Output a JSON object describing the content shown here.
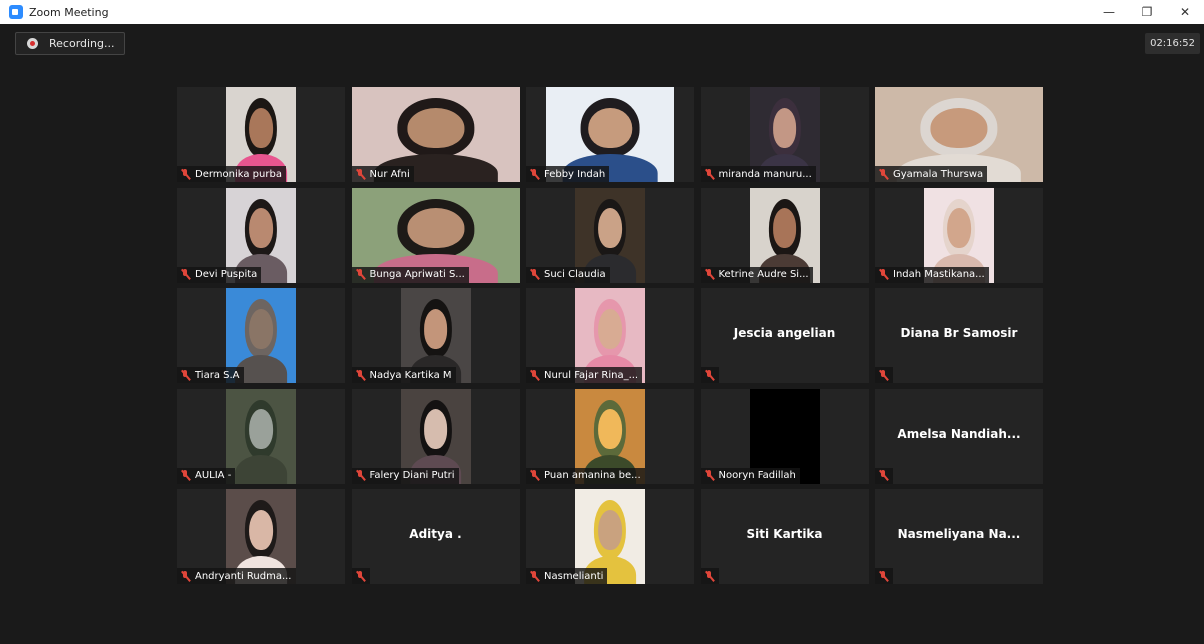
{
  "window": {
    "title": "Zoom Meeting",
    "minimize": "—",
    "maximize": "❐",
    "close": "✕"
  },
  "recording": {
    "label": "Recording..."
  },
  "timer": {
    "value": "02:16:52"
  },
  "participants": [
    {
      "name": "Dermonika purba",
      "muted": true,
      "video": true,
      "bg": "#d9d4cf",
      "skin": "#a9775a",
      "cloth": "#e8558f",
      "hair": "#1c1714"
    },
    {
      "name": "Nur Afni",
      "muted": true,
      "video": true,
      "bg": "#d8c3bf",
      "skin": "#b58a6c",
      "cloth": "#2a2220",
      "hair": "#201918"
    },
    {
      "name": "Febby Indah",
      "muted": true,
      "video": true,
      "bg": "#e9eef4",
      "skin": "#c69b7d",
      "cloth": "#2b4f8a",
      "hair": "#1f1c1f"
    },
    {
      "name": "miranda manuru...",
      "muted": true,
      "video": true,
      "bg": "#2f2b33",
      "skin": "#c39785",
      "cloth": "#3b3446",
      "hair": "#3c2f3d"
    },
    {
      "name": "Gyamala Thurswa",
      "muted": true,
      "video": true,
      "bg": "#cdb9a8",
      "skin": "#c79a7c",
      "cloth": "#e2dbd4",
      "hair": "#dcd6d1"
    },
    {
      "name": "Devi Puspita",
      "muted": true,
      "video": true,
      "bg": "#d7d3d6",
      "skin": "#b98970",
      "cloth": "#6a5c62",
      "hair": "#1d1817"
    },
    {
      "name": "Bunga Apriwati S...",
      "muted": true,
      "video": true,
      "bg": "#8ca17a",
      "skin": "#b98f73",
      "cloth": "#c86d8a",
      "hair": "#1d1a17"
    },
    {
      "name": "Suci Claudia",
      "muted": true,
      "video": true,
      "bg": "#3e3328",
      "skin": "#caa287",
      "cloth": "#2b2b2e",
      "hair": "#1a1716"
    },
    {
      "name": "Ketrine Audre Si...",
      "muted": true,
      "video": true,
      "bg": "#d8d3cc",
      "skin": "#a87458",
      "cloth": "#4b3b35",
      "hair": "#1b1614"
    },
    {
      "name": "Indah Mastikana...",
      "muted": true,
      "video": true,
      "bg": "#f0e1e3",
      "skin": "#d2a68c",
      "cloth": "#d9b9ad",
      "hair": "#e5d4cc"
    },
    {
      "name": "Tiara S.A",
      "muted": true,
      "video": true,
      "bg": "#3a8ad8",
      "skin": "#8a7566",
      "cloth": "#56514f",
      "hair": "#6d6561"
    },
    {
      "name": "Nadya Kartika M",
      "muted": true,
      "video": true,
      "bg": "#4a4645",
      "skin": "#c3957a",
      "cloth": "#2a2828",
      "hair": "#151312"
    },
    {
      "name": "Nurul Fajar Rina_...",
      "muted": true,
      "video": true,
      "bg": "#e7b9c3",
      "skin": "#d8ab93",
      "cloth": "#e68aa6",
      "hair": "#e697ac"
    },
    {
      "name": "Jescia angelian",
      "muted": true,
      "video": false
    },
    {
      "name": "Diana Br Samosir",
      "muted": true,
      "video": false
    },
    {
      "name": "AULIA -",
      "muted": true,
      "video": true,
      "bg": "#4c5443",
      "skin": "#9aa19a",
      "cloth": "#3d4436",
      "hair": "#2f3a2c"
    },
    {
      "name": "Falery Diani Putri",
      "muted": true,
      "video": true,
      "bg": "#4a4340",
      "skin": "#d6bcae",
      "cloth": "#5e4a52",
      "hair": "#141212"
    },
    {
      "name": "Puan amanina be...",
      "muted": true,
      "video": true,
      "bg": "#c9893f",
      "skin": "#f0b85a",
      "cloth": "#3c4a2a",
      "hair": "#5c6a3a"
    },
    {
      "name": "Nooryn Fadillah",
      "muted": true,
      "video": true,
      "bg": "#000000",
      "skin": "#000000",
      "cloth": "#000000",
      "hair": "#000000"
    },
    {
      "name": "Amelsa  Nandiah...",
      "muted": true,
      "video": false
    },
    {
      "name": "Andryanti Rudma...",
      "muted": true,
      "video": true,
      "bg": "#5b4d4a",
      "skin": "#d9b7a6",
      "cloth": "#efe3df",
      "hair": "#1e1a19"
    },
    {
      "name": "Aditya .",
      "muted": true,
      "video": false
    },
    {
      "name": "Nasmelianti",
      "muted": true,
      "video": true,
      "bg": "#f1ece4",
      "skin": "#c9a27f",
      "cloth": "#e4c23e",
      "hair": "#e4c23e"
    },
    {
      "name": "Siti Kartika",
      "muted": true,
      "video": false
    },
    {
      "name": "Nasmeliyana  Na...",
      "muted": true,
      "video": false
    }
  ]
}
